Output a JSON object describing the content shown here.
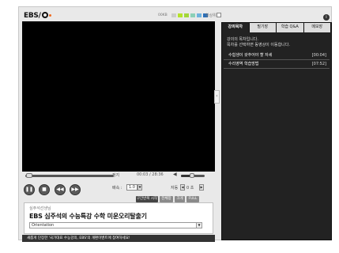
{
  "app": {
    "logo_text": "EBS",
    "title": "EBS 심주석의 수능특강 수학 미운오리탈출기",
    "teacher": "심주석선생님",
    "notice": "새롭게 단장한 '국가대표 수능강의, EBS'의 개편이벤트에 참여하세요!"
  },
  "topbar": {
    "speed_label": "00KB",
    "speed_blocks": [
      "#cccccc",
      "#b5e22b",
      "#a2d63a",
      "#8bd0b8",
      "#6fb3df",
      "#2b6fb8"
    ],
    "checkbox_label": "항상위"
  },
  "player": {
    "status": "정지",
    "time": "00:03 / 28:36",
    "seek_progress": 0.03,
    "volume_level": 0.45,
    "speed_label": "배속 :",
    "speed_value": "1.0",
    "sync_label": "자동",
    "sync_value": "0 초",
    "controls": [
      "pause",
      "stop",
      "rewind",
      "forward"
    ],
    "buttons": {
      "bookmark": "구간반복 시작",
      "fullscreen_a": "전체창",
      "size": "크게",
      "full": "FULL"
    },
    "lecture_select": "Orientation"
  },
  "panel": {
    "tabs": [
      "강의목차",
      "필기장",
      "학습 Q&A",
      "메모장"
    ],
    "active_tab": 0,
    "intro": "강의의 목차입니다.\n목차를 선택하면 동영상이 이동합니다.",
    "items": [
      {
        "label": "수험생이 갖추어야 할 자세",
        "time": "[00:04]"
      },
      {
        "label": "수리영역 학습방법",
        "time": "[07:52]"
      }
    ],
    "info_icon": "i"
  },
  "colors": {
    "frame_bg": "#e9e9e9",
    "panel_bg": "#222222",
    "accent_orange": "#f06a1e"
  }
}
